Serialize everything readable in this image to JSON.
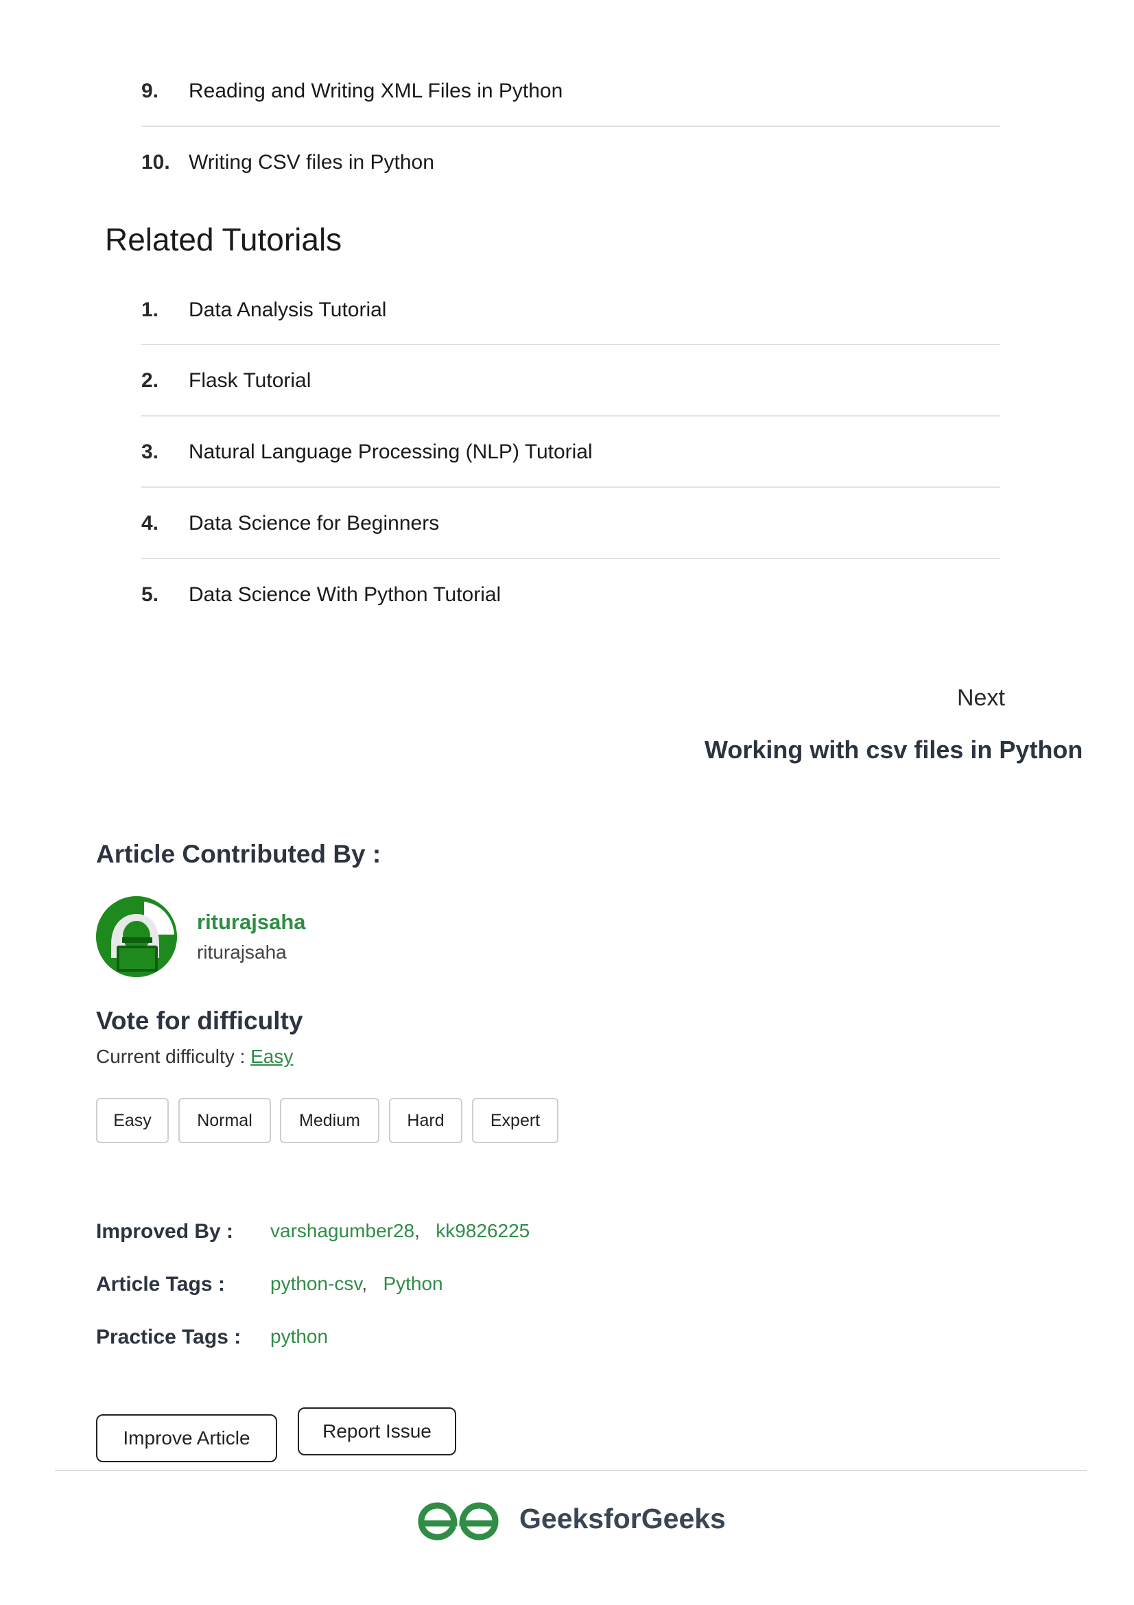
{
  "more_list": [
    {
      "num": "9.",
      "text": "Reading and Writing XML Files in Python"
    },
    {
      "num": "10.",
      "text": "Writing CSV files in Python"
    }
  ],
  "related": {
    "title": "Related Tutorials",
    "items": [
      {
        "num": "1.",
        "text": "Data Analysis Tutorial"
      },
      {
        "num": "2.",
        "text": "Flask Tutorial"
      },
      {
        "num": "3.",
        "text": "Natural Language Processing (NLP) Tutorial"
      },
      {
        "num": "4.",
        "text": "Data Science for Beginners"
      },
      {
        "num": "5.",
        "text": "Data Science With Python Tutorial"
      }
    ]
  },
  "next": {
    "label": "Next",
    "title": "Working with csv files in Python"
  },
  "contributor": {
    "heading": "Article Contributed By :",
    "name": "riturajsaha",
    "username": "riturajsaha"
  },
  "difficulty": {
    "heading": "Vote for difficulty",
    "current_label": "Current difficulty : ",
    "current_value": "Easy",
    "options": [
      "Easy",
      "Normal",
      "Medium",
      "Hard",
      "Expert"
    ]
  },
  "meta": {
    "improved_by_label": "Improved By :",
    "improved_by": [
      "varshagumber28",
      "kk9826225"
    ],
    "article_tags_label": "Article Tags :",
    "article_tags": [
      "python-csv",
      "Python"
    ],
    "practice_tags_label": "Practice Tags :",
    "practice_tags": [
      "python"
    ]
  },
  "actions": {
    "improve": "Improve Article",
    "report": "Report Issue"
  },
  "footer": {
    "brand": "GeeksforGeeks"
  },
  "colors": {
    "accent_green": "#2f8d46",
    "heading_dark": "#2c3440"
  }
}
